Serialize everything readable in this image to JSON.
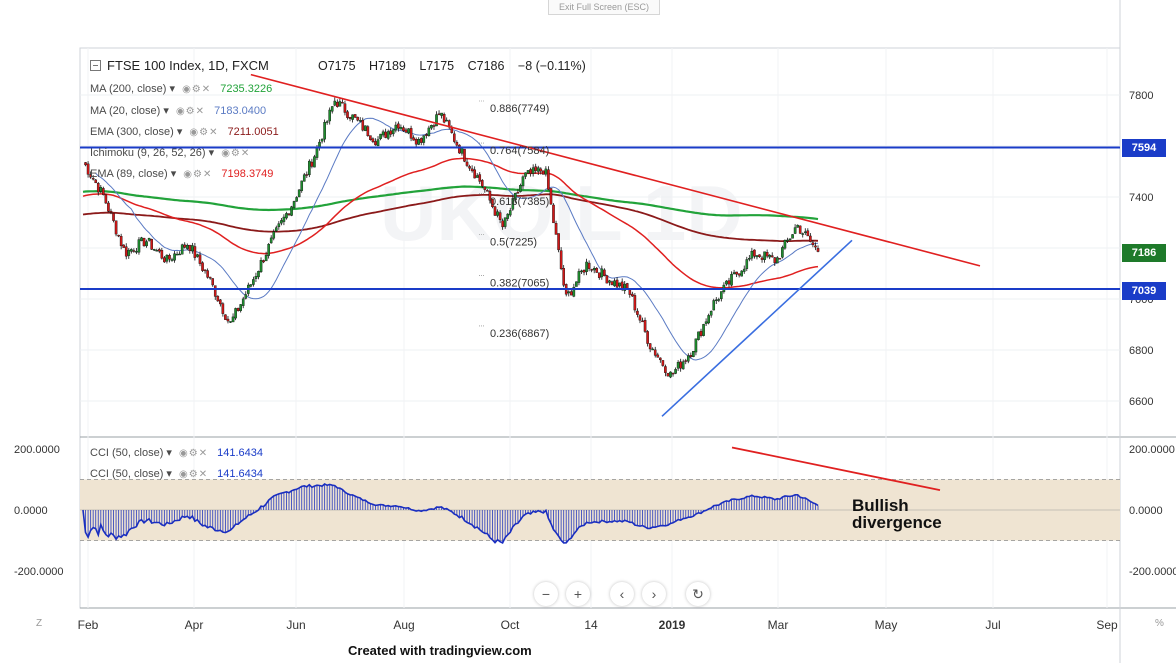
{
  "toolbar": {
    "fullscreen_label": "Exit Full Screen (ESC)"
  },
  "header": {
    "symbol": "FTSE 100 Index, 1D, FXCM",
    "open": "O7175",
    "high": "H7189",
    "low": "L7175",
    "close": "C7186",
    "change": "−8 (−0.11%)"
  },
  "studies": [
    {
      "label": "MA (200, close)",
      "value": "7235.3226",
      "color": "#22a33a"
    },
    {
      "label": "MA (20, close)",
      "value": "7183.0400",
      "color": "#5b7bc4"
    },
    {
      "label": "EMA (300, close)",
      "value": "7211.0051",
      "color": "#8b1a1a"
    },
    {
      "label": "Ichimoku (9, 26, 52, 26)",
      "value": "",
      "color": "#2962ff"
    },
    {
      "label": "EMA (89, close)",
      "value": "7198.3749",
      "color": "#e02020"
    }
  ],
  "cci_legends": [
    {
      "label": "CCI (50, close)",
      "value": "141.6434"
    },
    {
      "label": "CCI (50, close)",
      "value": "141.6434"
    }
  ],
  "price_badges": [
    {
      "text": "7594",
      "color": "#1a3cc8",
      "value": 7594
    },
    {
      "text": "7186",
      "color": "#1e7a2a",
      "value": 7186
    },
    {
      "text": "7039",
      "color": "#1a3cc8",
      "value": 7039
    }
  ],
  "annotation": {
    "line1": "Bullish",
    "line2": "divergence"
  },
  "credit": "Created with tradingview.com",
  "corner": {
    "left": "Z",
    "right": "%"
  },
  "nav_icons": [
    "minus-icon",
    "plus-icon",
    "chevron-left-icon",
    "chevron-right-icon",
    "reset-icon"
  ],
  "chart_data": {
    "type": "candlestick",
    "title": "FTSE 100 Index, 1D, FXCM",
    "x_ticks": [
      "Feb",
      "Apr",
      "Jun",
      "Aug",
      "Oct",
      "14",
      "2019",
      "Mar",
      "May",
      "Jul",
      "Sep"
    ],
    "y_ticks": [
      6600,
      6800,
      7000,
      7200,
      7400,
      7600,
      7800
    ],
    "ylim": [
      6420,
      7960
    ],
    "horizontal_lines": [
      {
        "value": 7594,
        "color": "#1a3cc8"
      },
      {
        "value": 7039,
        "color": "#1a3cc8"
      }
    ],
    "fibonacci": [
      {
        "label": "0.886(7749)",
        "value": 7749
      },
      {
        "label": "0.764(7584)",
        "value": 7584
      },
      {
        "label": "0.618(7385)",
        "value": 7385
      },
      {
        "label": "0.5(7225)",
        "value": 7225
      },
      {
        "label": "0.382(7065)",
        "value": 7065
      },
      {
        "label": "0.236(6867)",
        "value": 6867
      }
    ],
    "close_path": [
      {
        "x": "Feb",
        "y": 7540
      },
      {
        "x": "Feb",
        "y": 7400
      },
      {
        "x": "Feb",
        "y": 7180
      },
      {
        "x": "Feb",
        "y": 7230
      },
      {
        "x": "Mar",
        "y": 7150
      },
      {
        "x": "Mar",
        "y": 7220
      },
      {
        "x": "Mar",
        "y": 7080
      },
      {
        "x": "Apr",
        "y": 6900
      },
      {
        "x": "Apr",
        "y": 7060
      },
      {
        "x": "Apr",
        "y": 7230
      },
      {
        "x": "Apr",
        "y": 7380
      },
      {
        "x": "May",
        "y": 7560
      },
      {
        "x": "May",
        "y": 7780
      },
      {
        "x": "Jun",
        "y": 7700
      },
      {
        "x": "Jun",
        "y": 7620
      },
      {
        "x": "Jul",
        "y": 7690
      },
      {
        "x": "Jul",
        "y": 7620
      },
      {
        "x": "Aug",
        "y": 7730
      },
      {
        "x": "Aug",
        "y": 7580
      },
      {
        "x": "Aug",
        "y": 7450
      },
      {
        "x": "Sep",
        "y": 7280
      },
      {
        "x": "Sep",
        "y": 7480
      },
      {
        "x": "Oct",
        "y": 7510
      },
      {
        "x": "Oct",
        "y": 7000
      },
      {
        "x": "Oct",
        "y": 7140
      },
      {
        "x": "Nov",
        "y": 7080
      },
      {
        "x": "Nov",
        "y": 7030
      },
      {
        "x": "Dec",
        "y": 6820
      },
      {
        "x": "Dec",
        "y": 6700
      },
      {
        "x": "2019",
        "y": 6800
      },
      {
        "x": "Jan",
        "y": 6980
      },
      {
        "x": "Feb",
        "y": 7090
      },
      {
        "x": "Feb",
        "y": 7180
      },
      {
        "x": "Mar",
        "y": 7150
      },
      {
        "x": "Mar",
        "y": 7290
      },
      {
        "x": "Mar",
        "y": 7186
      }
    ],
    "cci": {
      "y_ticks": [
        200,
        0,
        -200
      ],
      "ylim": [
        -300,
        220
      ],
      "band": [
        -100,
        100
      ]
    }
  }
}
